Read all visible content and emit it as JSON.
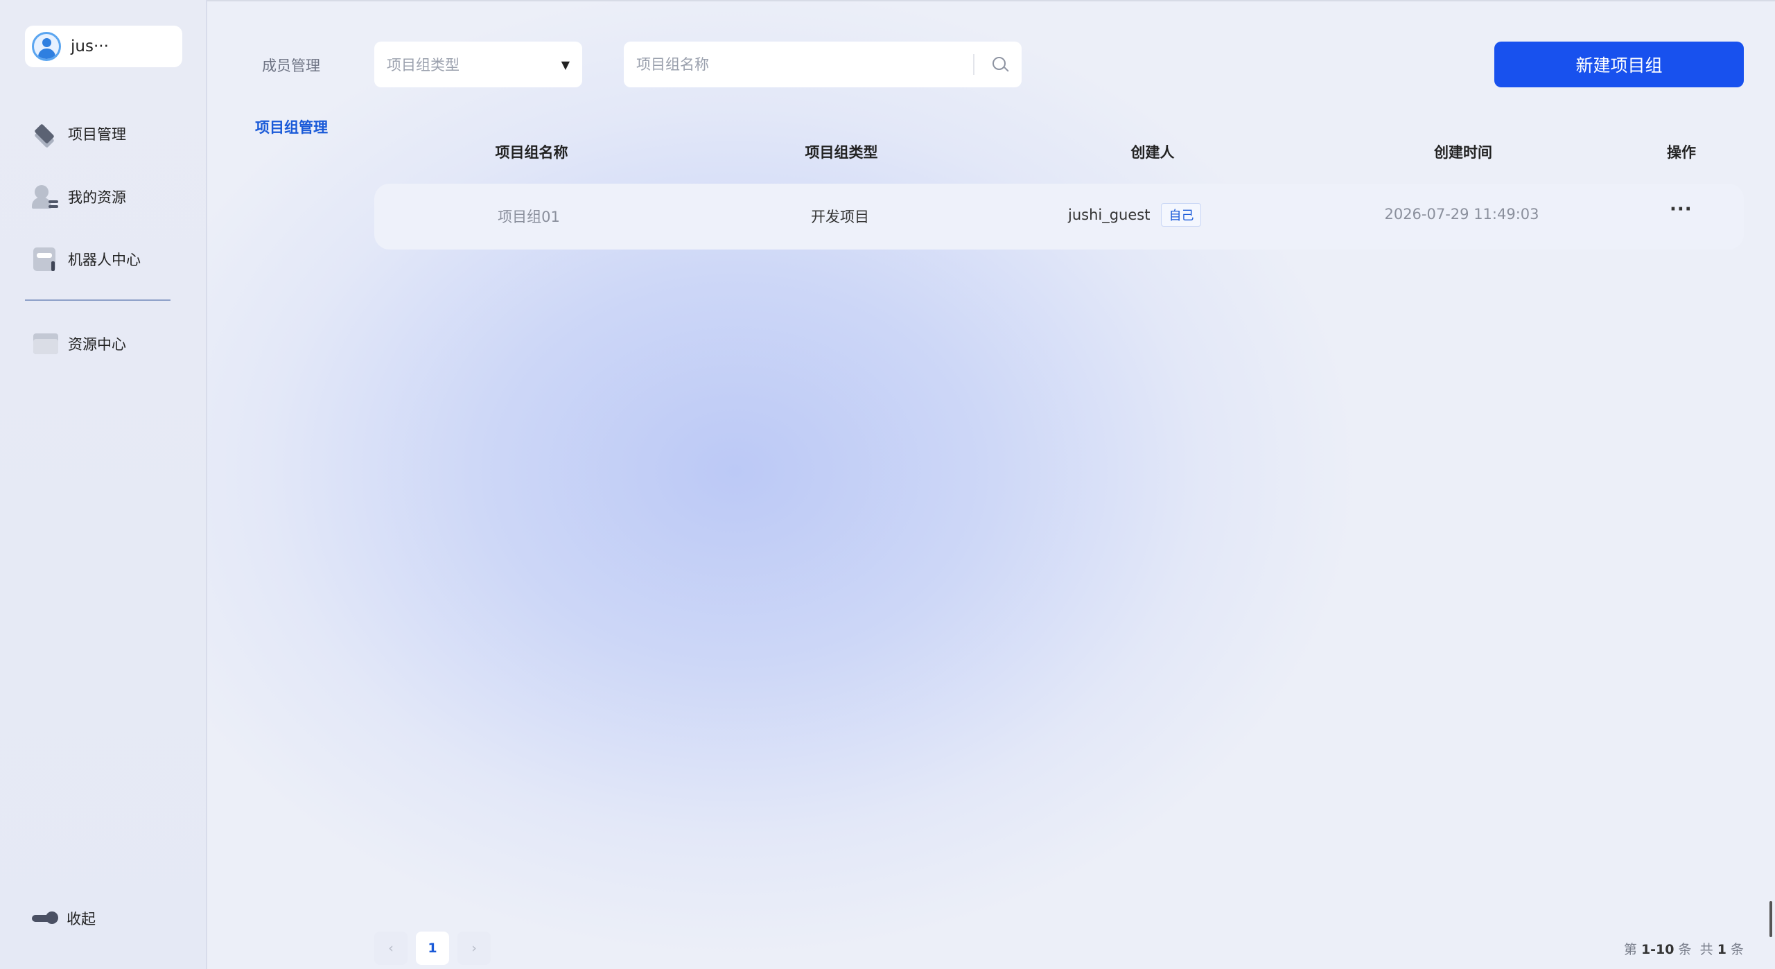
{
  "user": {
    "name": "jus···"
  },
  "sidebar": {
    "items": [
      {
        "label": "项目管理",
        "icon": "layers-icon"
      },
      {
        "label": "我的资源",
        "icon": "user-resource-icon"
      },
      {
        "label": "机器人中心",
        "icon": "robot-icon"
      },
      {
        "label": "资源中心",
        "icon": "folder-icon"
      }
    ],
    "collapse_label": "收起"
  },
  "subnav": {
    "items": [
      {
        "label": "成员管理",
        "active": false
      },
      {
        "label": "项目组管理",
        "active": true
      }
    ]
  },
  "filters": {
    "type_placeholder": "项目组类型",
    "name_placeholder": "项目组名称"
  },
  "toolbar": {
    "new_label": "新建项目组"
  },
  "table": {
    "headers": [
      "项目组名称",
      "项目组类型",
      "创建人",
      "创建时间",
      "操作"
    ],
    "rows": [
      {
        "name": "项目组01",
        "type": "开发项目",
        "creator": "jushi_guest",
        "creator_badge": "自己",
        "created_at": "2026-07-29 11:49:03",
        "action": "···"
      }
    ]
  },
  "pagination": {
    "prev": "‹",
    "current": "1",
    "next": "›",
    "summary_prefix": "第",
    "summary_range": "1-10",
    "summary_unit": "条",
    "summary_total_prefix": "共",
    "summary_total": "1",
    "summary_total_unit": "条"
  },
  "colors": {
    "accent": "#1851ee",
    "active_text": "#1a5ad8"
  }
}
